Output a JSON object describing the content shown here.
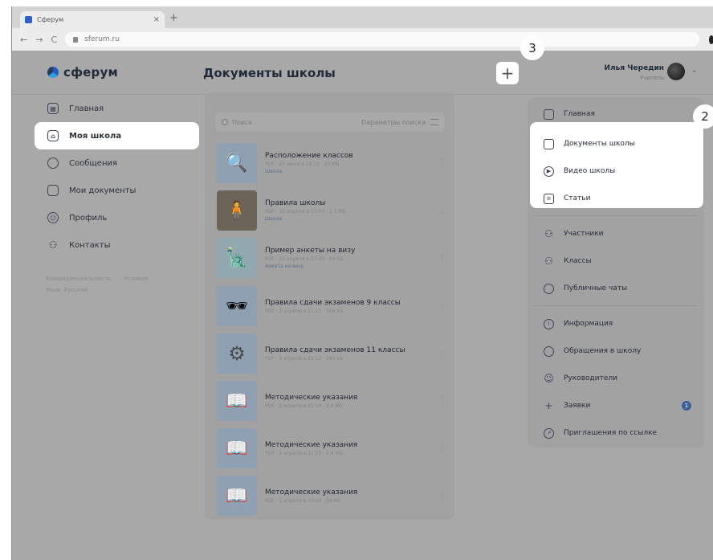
{
  "browser": {
    "tab_title": "Сферум",
    "tab_close": "×",
    "new_tab": "+",
    "back": "←",
    "forward": "→",
    "reload": "C",
    "url": "sferum.ru"
  },
  "header": {
    "logo": "сферум",
    "page_title": "Документы школы",
    "add_button": "+",
    "user_name": "Илья Чередин",
    "user_role": "Учитель",
    "chevron": "⌄"
  },
  "left_nav": {
    "items": [
      {
        "label": "Главная",
        "icon": "grid-icon",
        "glyph": "▦"
      },
      {
        "label": "Моя школа",
        "icon": "school-icon",
        "glyph": "⌂"
      },
      {
        "label": "Сообщения",
        "icon": "chat-icon",
        "glyph": ""
      },
      {
        "label": "Мои документы",
        "icon": "document-icon",
        "glyph": ""
      },
      {
        "label": "Профиль",
        "icon": "profile-icon",
        "glyph": "☺"
      },
      {
        "label": "Контакты",
        "icon": "contacts-icon",
        "glyph": "⚇"
      }
    ],
    "footer": {
      "privacy": "Конфиденциальность",
      "terms": "Условия",
      "language": "Язык: Русский"
    }
  },
  "search": {
    "placeholder": "Поиск",
    "params": "Параметры поиска"
  },
  "documents": [
    {
      "title": "Расположение классов",
      "meta": "PDF · 20 июня в 18:15 · 20 MБ",
      "tag": "Школа",
      "thumb": "🔍"
    },
    {
      "title": "Правила школы",
      "meta": "PDF · 15 апреля в 17:04 · 2,7 MБ",
      "tag": "Школа",
      "thumb": "🧍"
    },
    {
      "title": "Пример анкеты на визу",
      "meta": "PDF · 15 апреля в 17:09 · 64 KБ",
      "tag": "Анкета на визу",
      "thumb": "🗽"
    },
    {
      "title": "Правила сдачи экзаменов 9 классы",
      "meta": "PDF · 3 апреля в 21:13 · 154 KБ",
      "tag": "",
      "thumb": "🕶"
    },
    {
      "title": "Правила сдачи экзаменов 11 классы",
      "meta": "PDF · 3 апреля в 21:12 · 284 KБ",
      "tag": "",
      "thumb": "⚙"
    },
    {
      "title": "Методические указания",
      "meta": "PDF · 2 апреля в 21:10 · 2,4 MБ",
      "tag": "",
      "thumb": "📖"
    },
    {
      "title": "Методические указания",
      "meta": "PDF · 2 апреля в 21:10 · 2,4 MБ",
      "tag": "",
      "thumb": "📖"
    },
    {
      "title": "Методические указания",
      "meta": "PDF · 1 апреля в 10:44 · 34 MБ",
      "tag": "",
      "thumb": "📖"
    }
  ],
  "right_nav": {
    "items": [
      {
        "label": "Главная",
        "icon": "home-icon",
        "glyph": ""
      },
      {
        "label": "Документы школы",
        "icon": "document-icon",
        "glyph": ""
      },
      {
        "label": "Видео школы",
        "icon": "video-icon",
        "glyph": "▶"
      },
      {
        "label": "Статьи",
        "icon": "article-icon",
        "glyph": "≡"
      },
      {
        "label": "Участники",
        "icon": "members-icon",
        "glyph": "⚇"
      },
      {
        "label": "Классы",
        "icon": "classes-icon",
        "glyph": "⚇"
      },
      {
        "label": "Публичные чаты",
        "icon": "public-chats-icon",
        "glyph": ""
      },
      {
        "label": "Информация",
        "icon": "info-icon",
        "glyph": "i"
      },
      {
        "label": "Обращения в школу",
        "icon": "appeal-icon",
        "glyph": ""
      },
      {
        "label": "Руководители",
        "icon": "leaders-icon",
        "glyph": "☺"
      },
      {
        "label": "Заявки",
        "icon": "requests-icon",
        "glyph": "+",
        "badge": "1"
      },
      {
        "label": "Приглашения по ссылке",
        "icon": "link-icon",
        "glyph": "↗"
      }
    ]
  },
  "callouts": {
    "step3": "3",
    "step2": "2"
  },
  "colors": {
    "overlay": "#a8a8a8",
    "highlight": "#ffffff",
    "accent": "#3e5f9a"
  }
}
